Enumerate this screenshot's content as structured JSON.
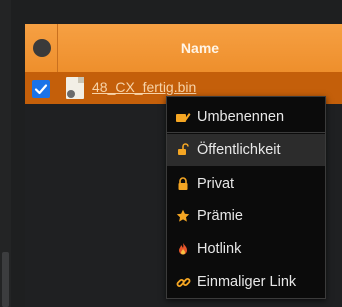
{
  "table": {
    "header": {
      "name_label": "Name"
    },
    "rows": [
      {
        "file_name": "48_CX_fertig.bin",
        "checked": true
      }
    ]
  },
  "context_menu": {
    "items": [
      {
        "label": "Umbenennen",
        "icon": "rename-icon"
      },
      {
        "label": "Öffentlichkeit",
        "icon": "unlock-icon"
      },
      {
        "label": "Privat",
        "icon": "lock-icon"
      },
      {
        "label": "Prämie",
        "icon": "star-icon"
      },
      {
        "label": "Hotlink",
        "icon": "fire-icon"
      },
      {
        "label": "Einmaliger Link",
        "icon": "link-icon"
      }
    ]
  },
  "colors": {
    "header_orange": "#f39a3c",
    "selected_row": "#c45f0a",
    "checkbox_blue": "#1a73e8",
    "menu_bg": "#0b0b0b"
  }
}
